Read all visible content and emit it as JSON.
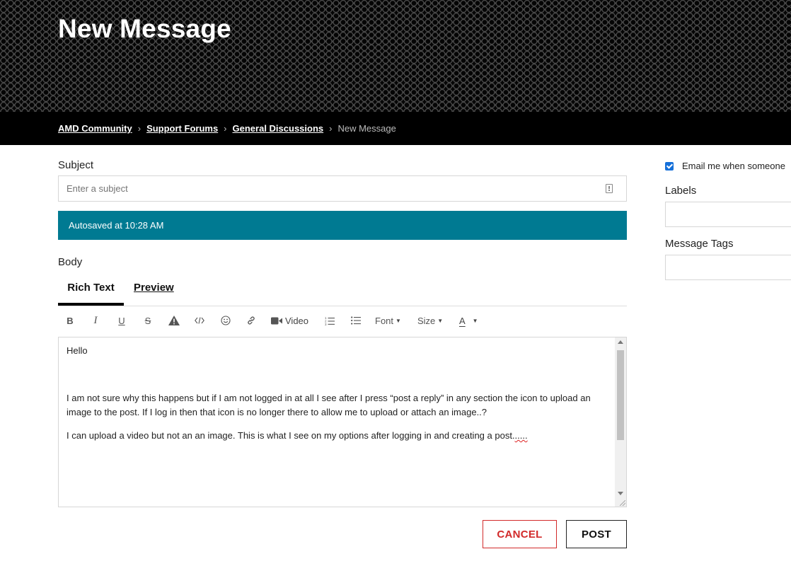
{
  "header": {
    "title": "New Message"
  },
  "breadcrumb": {
    "items": [
      "AMD Community",
      "Support Forums",
      "General Discussions"
    ],
    "current": "New Message",
    "separator": "›"
  },
  "form": {
    "subject_label": "Subject",
    "subject_placeholder": "Enter a subject",
    "autosave_text": "Autosaved at 10:28 AM",
    "body_label": "Body",
    "tabs": [
      {
        "label": "Rich Text",
        "active": true
      },
      {
        "label": "Preview",
        "active": false
      }
    ],
    "toolbar": {
      "video_label": "Video",
      "font_label": "Font",
      "size_label": "Size",
      "font_color_label": "A",
      "icons": [
        "bold-icon",
        "italic-icon",
        "underline-icon",
        "strikethrough-icon",
        "spoiler-warning-icon",
        "code-icon",
        "emoji-icon",
        "link-icon",
        "video-camera-icon",
        "numbered-list-icon",
        "bulleted-list-icon"
      ]
    },
    "body_text": {
      "p1": "Hello",
      "p2": "I am not sure why this happens but if I am not logged in at all I see after I press “post a reply” in any section the icon to upload an image to the post. If I log in then that icon is no longer there to allow me to upload or attach an image..?",
      "p3_main": "I can upload a video but not an an image. This is what I see on my options after logging in and creating a post.",
      "p3_misspelled": "....."
    },
    "cancel_label": "CANCEL",
    "post_label": "POST"
  },
  "sidebar": {
    "email_notify_label": "Email me when someone",
    "email_notify_checked": true,
    "labels_label": "Labels",
    "message_tags_label": "Message Tags"
  },
  "colors": {
    "autosave_bg": "#007a92",
    "cancel_red": "#d22a2a",
    "checkbox_blue": "#1670d9"
  }
}
